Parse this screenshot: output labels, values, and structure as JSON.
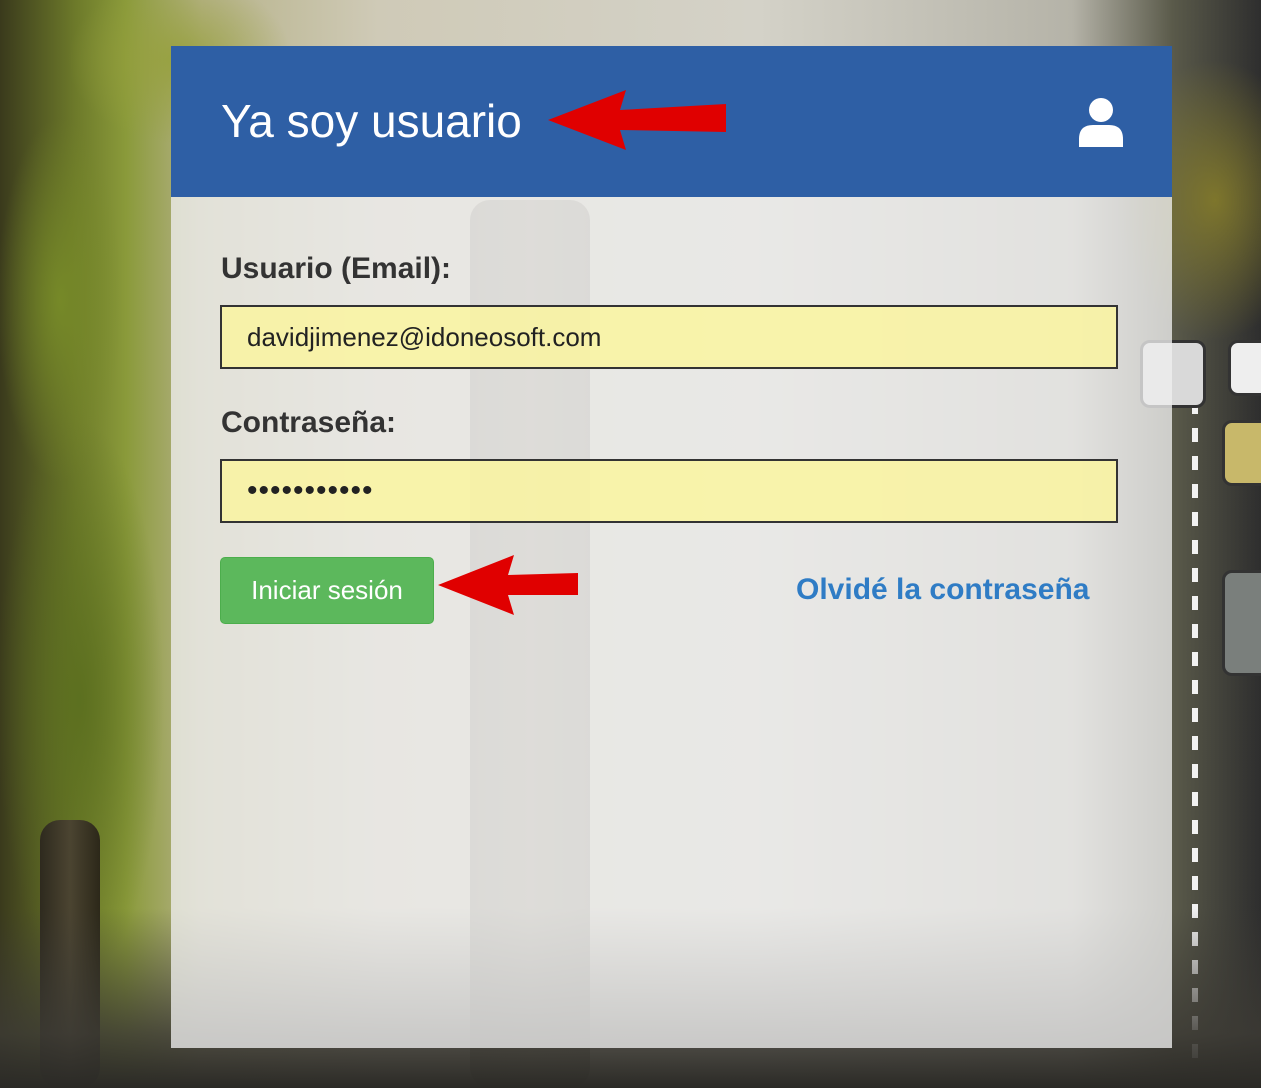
{
  "login_card": {
    "title": "Ya soy usuario",
    "email_label": "Usuario (Email):",
    "email_value": "davidjimenez@idoneosoft.com",
    "password_label": "Contraseña:",
    "password_value": "•••••••••••",
    "login_button": "Iniciar sesión",
    "forgot_link": "Olvidé la contraseña"
  },
  "colors": {
    "header": "#2e5fa5",
    "button": "#5cb85c",
    "link": "#2f7cc5",
    "annotation_arrow": "#e00000"
  },
  "icons": {
    "header_icon": "user-icon",
    "annotations": "red-arrow-icon"
  }
}
